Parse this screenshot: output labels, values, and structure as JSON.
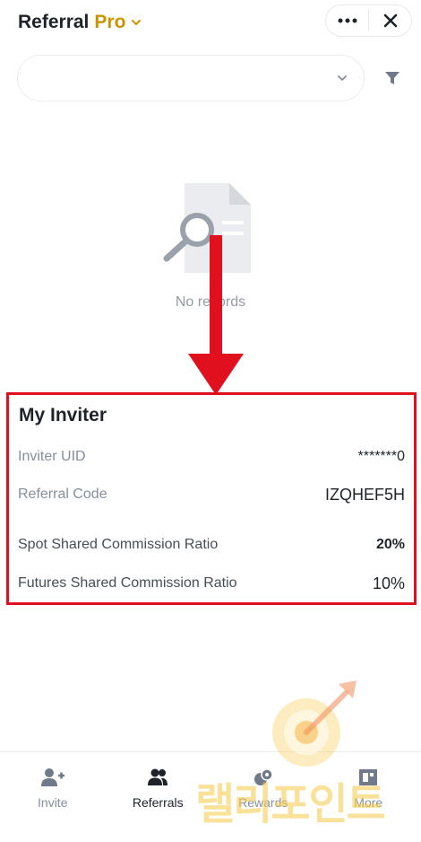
{
  "header": {
    "title": "Referral",
    "title_accent": "Pro",
    "accent_color": "#c99400"
  },
  "filter": {
    "selected": ""
  },
  "empty_state": {
    "message": "No records"
  },
  "inviter": {
    "title": "My Inviter",
    "rows": [
      {
        "label": "Inviter UID",
        "value": "*******0"
      },
      {
        "label": "Referral Code",
        "value": "IZQHEF5H"
      },
      {
        "label": "Spot Shared Commission Ratio",
        "value": "20%"
      },
      {
        "label": "Futures Shared Commission Ratio",
        "value": "10%"
      }
    ],
    "highlight_color": "#e0101e"
  },
  "bottom_nav": {
    "items": [
      {
        "label": "Invite",
        "icon": "add-user-icon"
      },
      {
        "label": "Referrals",
        "icon": "users-icon",
        "active": true
      },
      {
        "label": "Rewards",
        "icon": "rewards-icon"
      },
      {
        "label": "More",
        "icon": "more-icon"
      }
    ]
  },
  "watermark": {
    "text": "랠리포인트"
  }
}
